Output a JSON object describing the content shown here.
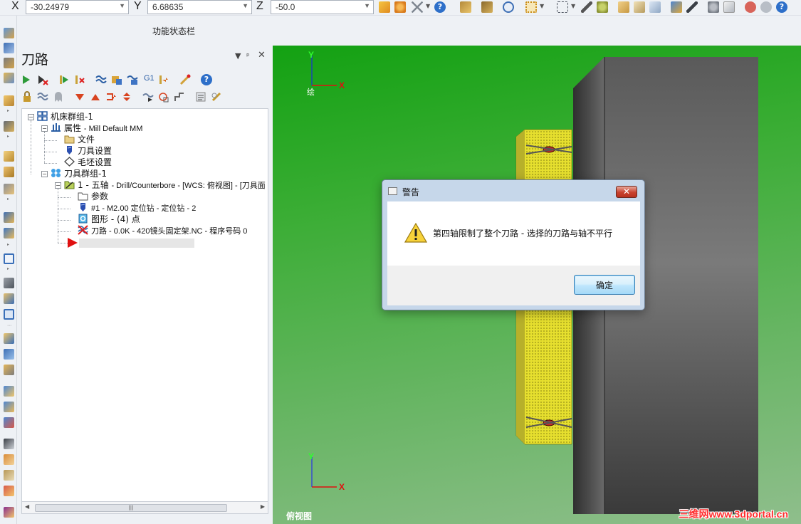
{
  "coords": {
    "x_label": "X",
    "x_value": "-30.24979",
    "y_label": "Y",
    "y_value": "6.68635",
    "z_label": "Z",
    "z_value": "-50.0"
  },
  "status_bar_label": "功能状态栏",
  "panel": {
    "title": "刀路",
    "pin_label": "▾ ᵖ ✕",
    "toolbar_row1_text": "G1",
    "help_label": "?"
  },
  "tree": {
    "machine_group": "机床群组-1",
    "properties": "属性",
    "properties_sub": "Mill Default MM",
    "files": "文件",
    "tool_settings": "刀具设置",
    "stock_settings": "毛坯设置",
    "toolpath_group": "刀具群组-1",
    "operation": "1 - 五轴",
    "operation_sub": "Drill/Counterbore - [WCS: 俯视图] - [刀具面",
    "params": "参数",
    "tool": "#1 - M2.00 定位钻 - 定位钻 - 2",
    "geometry": "图形 - (4) 点",
    "toolpath": "刀路 - 0.0K - 420镜头固定架.NC - 程序号码 0"
  },
  "viewport": {
    "view_name": "俯视图",
    "view_tag": "绘",
    "axis_y": "Y",
    "axis_x": "X",
    "watermark": "三维网www.3dportal.cn"
  },
  "dialog": {
    "title": "警告",
    "close_label": "✕",
    "message": "第四轴限制了整个刀路 - 选择的刀路与轴不平行",
    "ok_label": "确定"
  },
  "colors": {
    "viewport_top": "#13a112",
    "viewport_bottom": "#8fbe8c",
    "dialog_frame": "#c6d7ea",
    "close_button": "#c9432f"
  }
}
